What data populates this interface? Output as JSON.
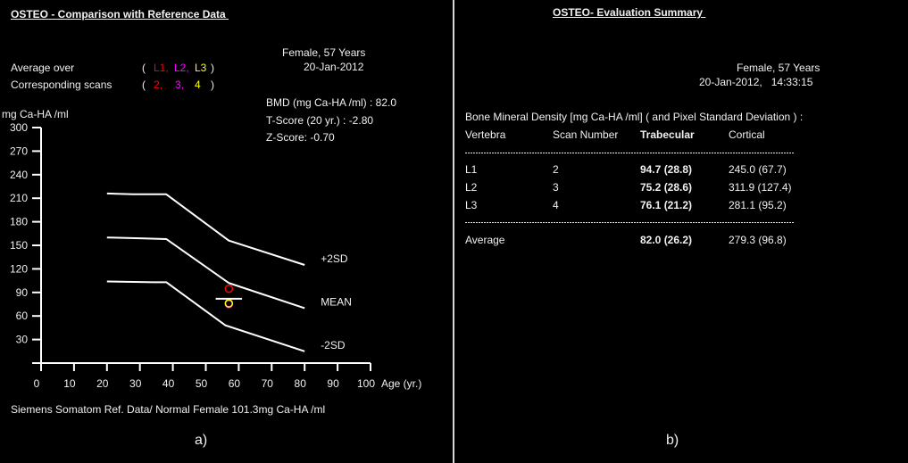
{
  "left_panel": {
    "title": "OSTEO - Comparison with Reference Data ",
    "patient": "Female, 57 Years",
    "date": "20-Jan-2012",
    "average_over_label": "Average over",
    "corresponding_scans_label": "Corresponding scans",
    "paren_open": "(",
    "paren_close": ")",
    "average_over_items": [
      {
        "text": "L1,",
        "color": "#ff0000"
      },
      {
        "text": "L2,",
        "color": "#ff00ff"
      },
      {
        "text": "L3",
        "color": "#ffff00"
      }
    ],
    "scan_items": [
      {
        "text": "2,",
        "color": "#ff0000"
      },
      {
        "text": "3,",
        "color": "#ff00ff"
      },
      {
        "text": "4",
        "color": "#ffff00"
      }
    ],
    "bmd": "BMD (mg Ca-HA /ml) : 82.0",
    "t_score": "T-Score (20 yr.) : -2.80",
    "z_score": "Z-Score: -0.70",
    "footer": "Siemens Somatom Ref. Data/ Normal Female 101.3mg Ca-HA /ml",
    "caption": "a)"
  },
  "chart_data": {
    "type": "line",
    "title": "",
    "xlabel": "Age (yr.)",
    "ylabel": "mg Ca-HA /ml",
    "xlim": [
      0,
      100
    ],
    "ylim": [
      0,
      300
    ],
    "xticks": [
      0,
      10,
      20,
      30,
      40,
      50,
      60,
      70,
      80,
      90,
      100
    ],
    "yticks": [
      30,
      60,
      90,
      120,
      150,
      180,
      210,
      240,
      270,
      300
    ],
    "grid": false,
    "series": [
      {
        "name": "+2SD",
        "label": "+2SD",
        "points": [
          [
            20,
            216
          ],
          [
            28,
            215
          ],
          [
            38,
            215
          ],
          [
            57,
            156
          ],
          [
            80,
            125
          ]
        ]
      },
      {
        "name": "MEAN",
        "label": "MEAN",
        "points": [
          [
            20,
            160
          ],
          [
            30,
            159
          ],
          [
            38,
            158
          ],
          [
            57,
            102
          ],
          [
            80,
            70
          ]
        ]
      },
      {
        "name": "-2SD",
        "label": "-2SD",
        "points": [
          [
            20,
            104
          ],
          [
            34,
            103
          ],
          [
            38,
            103
          ],
          [
            56,
            48
          ],
          [
            80,
            15
          ]
        ]
      }
    ],
    "patient_points": [
      {
        "name": "L1",
        "age": 57,
        "value": 94.7,
        "color": "#ff0000",
        "marker": "circle"
      },
      {
        "name": "L2",
        "age": 57,
        "value": 75.2,
        "color": "#ff00ff",
        "marker": "circle"
      },
      {
        "name": "L3",
        "age": 57,
        "value": 76.1,
        "color": "#ffff00",
        "marker": "circle"
      }
    ],
    "average_marker": {
      "name": "Average",
      "age_span": [
        53,
        61
      ],
      "value": 82.0,
      "color": "#ffffff"
    }
  },
  "right_panel": {
    "title": "OSTEO- Evaluation Summary ",
    "patient": "Female, 57 Years",
    "datetime": "20-Jan-2012,   14:33:15",
    "table_caption": "Bone Mineral Density [mg Ca-HA /ml] ( and Pixel Standard Deviation ) :",
    "columns": {
      "vertebra": "Vertebra",
      "scan": "Scan Number",
      "trabecular": "Trabecular",
      "cortical": "Cortical"
    },
    "rows": [
      {
        "vertebra": "L1",
        "scan": "2",
        "trabecular": "94.7 (28.8)",
        "cortical": "245.0 (67.7)"
      },
      {
        "vertebra": "L2",
        "scan": "3",
        "trabecular": "75.2 (28.6)",
        "cortical": "311.9 (127.4)"
      },
      {
        "vertebra": "L3",
        "scan": "4",
        "trabecular": "76.1 (21.2)",
        "cortical": "281.1 (95.2)"
      }
    ],
    "average": {
      "vertebra": "Average",
      "trabecular": "82.0 (26.2)",
      "cortical": "279.3 (96.8)"
    },
    "caption": "b)"
  }
}
